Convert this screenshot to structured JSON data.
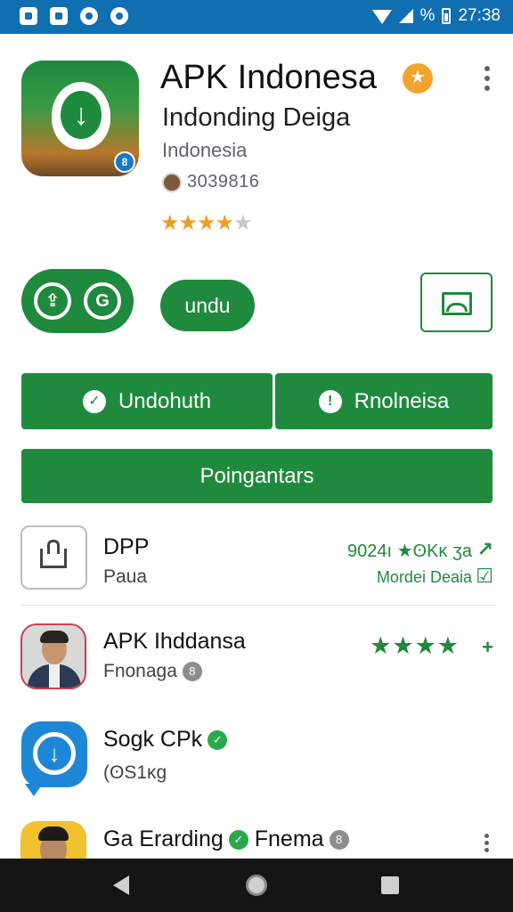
{
  "status_bar": {
    "battery_percent_glyph": "%",
    "time": "27:38"
  },
  "app": {
    "title": "APK Indonesa",
    "subtitle": "Indonding Deiga",
    "country": "Indonesia",
    "developer_count": "3039816",
    "rating_filled_stars": 4,
    "rating_total_stars": 5
  },
  "actions": {
    "unduh_label": "undu",
    "left_segment_label": "Undohuth",
    "right_segment_label": "Rnolneisa",
    "wide_label": "Poingantars"
  },
  "list": [
    {
      "title": "DPP",
      "subtitle": "Paua",
      "meta_primary": "9024ı ★ʘKĸ ʒa",
      "meta_secondary": "Mordei Deaia"
    },
    {
      "title": "APK Ihddansa",
      "subtitle": "Fnonaga",
      "stars": "★★★★"
    },
    {
      "title": "Sogk CPk",
      "subtitle": "(ʘS1ĸg"
    },
    {
      "title": "Ga Erarding",
      "title_suffix": "Fnema"
    }
  ],
  "icons": {
    "notification_icons": [
      "image-icon",
      "mail-icon",
      "record-icon",
      "chat-icon"
    ],
    "accent": "#1f8a3d",
    "status_bar_color": "#0f6fb0"
  }
}
